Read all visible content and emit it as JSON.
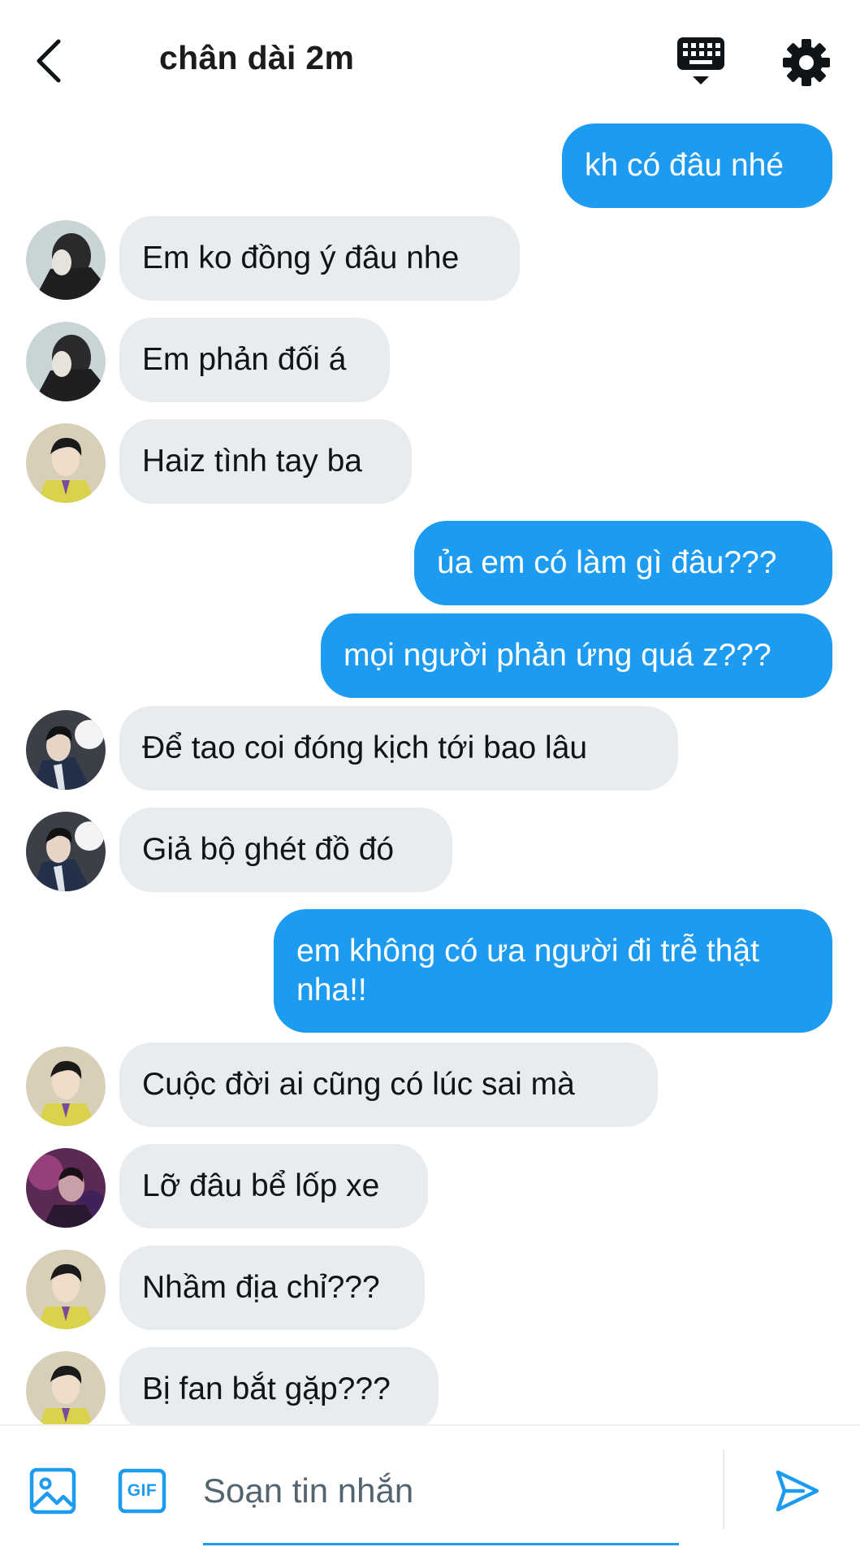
{
  "header": {
    "title": "chân dài 2m",
    "back_icon": "chevron-left-icon",
    "keyboard_icon": "keyboard-icon",
    "settings_icon": "gear-icon"
  },
  "messages": [
    {
      "side": "out",
      "text": "kh có đâu nhé"
    },
    {
      "side": "in",
      "avatar": "avatar-a",
      "text": "Em ko đồng ý đâu nhe"
    },
    {
      "side": "in",
      "avatar": "avatar-a",
      "text": "Em phản đối á"
    },
    {
      "side": "in",
      "avatar": "avatar-b",
      "text": "Haiz tình tay ba"
    },
    {
      "side": "out",
      "text": "ủa em có làm gì đâu???"
    },
    {
      "side": "out",
      "text": "mọi người phản ứng quá z???"
    },
    {
      "side": "in",
      "avatar": "avatar-c",
      "text": "Để tao coi đóng kịch tới bao lâu"
    },
    {
      "side": "in",
      "avatar": "avatar-c",
      "text": "Giả bộ ghét đồ đó"
    },
    {
      "side": "out",
      "text": "em không có ưa người đi trễ thật nha!!"
    },
    {
      "side": "in",
      "avatar": "avatar-b",
      "text": "Cuộc đời ai cũng có lúc sai mà"
    },
    {
      "side": "in",
      "avatar": "avatar-d",
      "text": "Lỡ đâu bể lốp xe"
    },
    {
      "side": "in",
      "avatar": "avatar-b",
      "text": "Nhầm địa chỉ???"
    },
    {
      "side": "in",
      "avatar": "avatar-b",
      "text": "Bị fan bắt gặp???"
    }
  ],
  "composer": {
    "placeholder": "Soạn tin nhắn",
    "image_icon": "image-icon",
    "gif_label": "GIF",
    "send_icon": "send-icon"
  },
  "colors": {
    "accent": "#1d9bf0",
    "incoming_bubble": "#e9ecef",
    "text": "#0f1419"
  }
}
